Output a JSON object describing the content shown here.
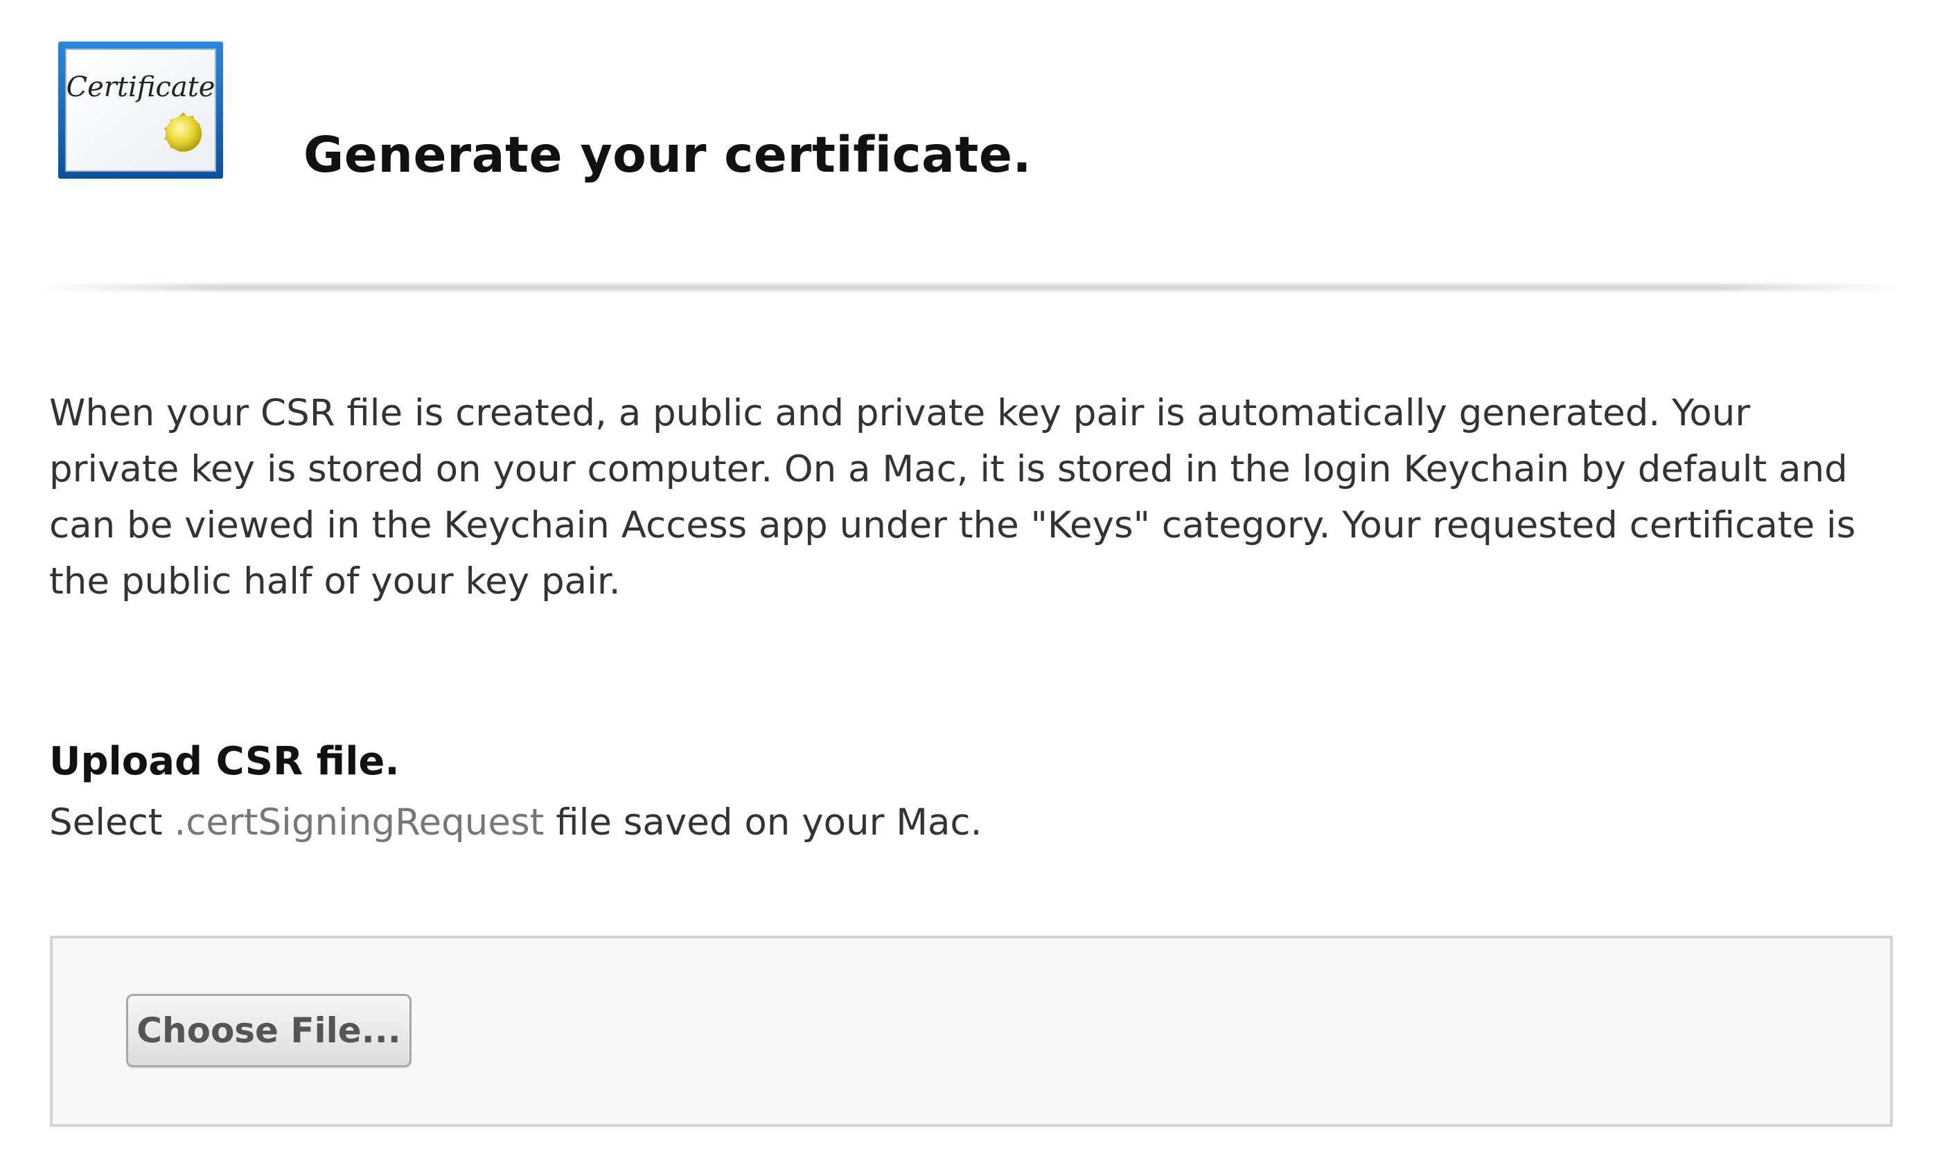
{
  "header": {
    "icon": "certificate-icon",
    "icon_text": "Certificate",
    "title": "Generate your certificate."
  },
  "intro_text": "When your CSR file is created, a public and private key pair is automatically generated. Your private key is stored on your computer. On a Mac, it is stored in the login Keychain by default and can be viewed in the Keychain Access app under the \"Keys\" category. Your requested certificate is the public half of your key pair.",
  "upload": {
    "title": "Upload CSR file.",
    "desc_prefix": "Select ",
    "desc_extension": ".certSigningRequest",
    "desc_suffix": " file saved on your Mac.",
    "button_label": "Choose File..."
  },
  "colors": {
    "icon_border": "#1565c0",
    "seal": "#e8d530",
    "upload_box_bg": "#f8f8f8",
    "upload_box_border": "#d4d4d4"
  }
}
